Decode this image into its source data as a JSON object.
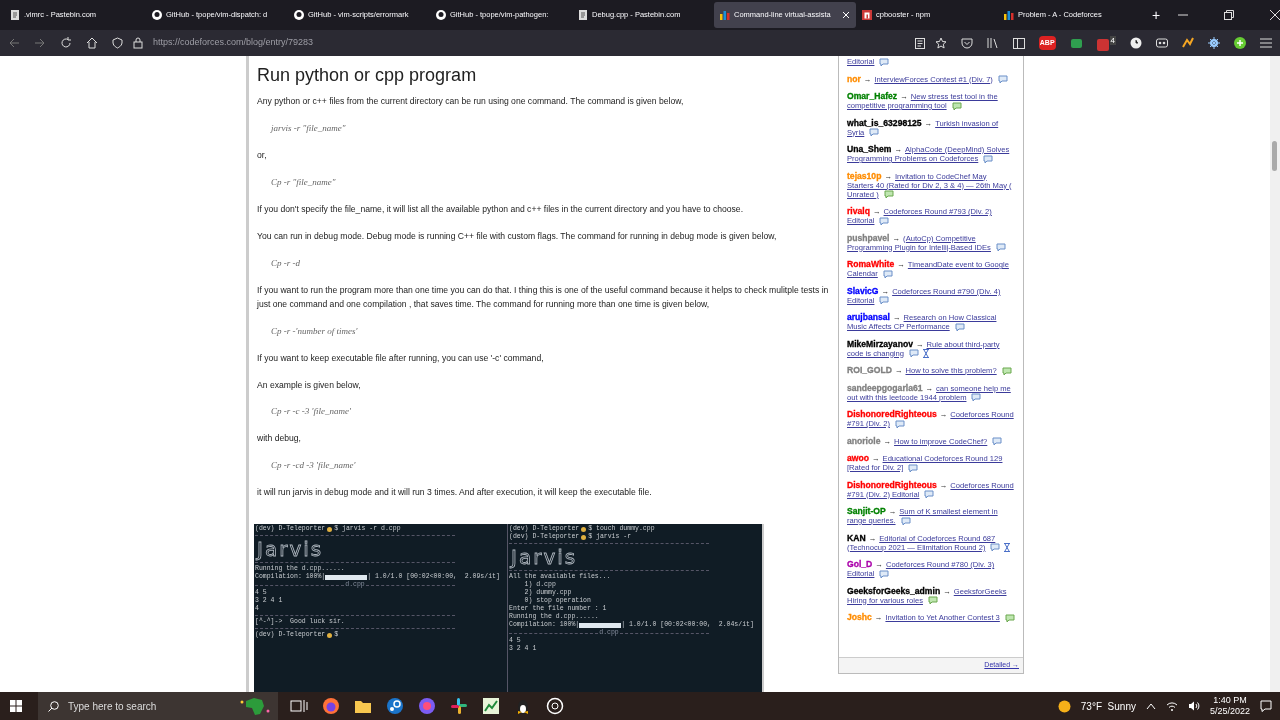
{
  "browser": {
    "tabs": [
      {
        "label": ".vimrc - Pastebin.com",
        "kind": "pastebin",
        "selected": false
      },
      {
        "label": "GitHub - tpope/vim-dispatch: d",
        "kind": "github",
        "selected": false
      },
      {
        "label": "GitHub - vim-scripts/errormark",
        "kind": "github",
        "selected": false
      },
      {
        "label": "GitHub - tpope/vim-pathogen:",
        "kind": "github",
        "selected": false
      },
      {
        "label": "Debug.cpp - Pastebin.com",
        "kind": "pastebin",
        "selected": false
      },
      {
        "label": "Command-line virtual-assista",
        "kind": "codeforces",
        "selected": true
      },
      {
        "label": "cpbooster - npm",
        "kind": "npm",
        "selected": false
      },
      {
        "label": "Problem - A - Codeforces",
        "kind": "codeforces",
        "selected": false
      }
    ],
    "new_tab": "+",
    "url": "https://codeforces.com/blog/entry/79283",
    "extensions": {
      "adblock_label": "ABP",
      "badge": "4"
    }
  },
  "article": {
    "blocks": [
      {
        "kind": "heading",
        "text": "Run python or cpp program"
      },
      {
        "kind": "para",
        "text": "Any python or c++ files from the current directory can be run using one command. The command is given below,"
      },
      {
        "kind": "code",
        "text": "jarvis -r \"file_name\""
      },
      {
        "kind": "para",
        "text": "or,"
      },
      {
        "kind": "code",
        "text": "Cp -r \"file_name\""
      },
      {
        "kind": "para",
        "text": "If you don't specify the file_name, it will list all the available python and c++ files in the current directory and you have to choose."
      },
      {
        "kind": "para",
        "text": "You can run in debug mode. Debug mode is running C++ file with custom flags. The command for running in debug mode is given below,"
      },
      {
        "kind": "code",
        "text": "Cp -r -d"
      },
      {
        "kind": "para",
        "text": "If you want to run the program more than one time you can do that. I thing this is one of the useful command because it helps to check mulitple tests in just one command and one compilation , that saves time. The command for running more than one time is given below,"
      },
      {
        "kind": "code",
        "text": "Cp -r -'number of times'"
      },
      {
        "kind": "para",
        "text": "If you want to keep executable file after running, you can use '-c' command,"
      },
      {
        "kind": "para",
        "text": "An example is given below,"
      },
      {
        "kind": "code",
        "text": "Cp -r -c -3 'file_name'"
      },
      {
        "kind": "para",
        "text": "with debug,"
      },
      {
        "kind": "code",
        "text": "Cp -r -cd -3 'file_name'"
      },
      {
        "kind": "para",
        "text": "it will run jarvis in debug mode and it will run 3 times. And after execution, it will keep the executable file."
      }
    ],
    "terminal_screenshot": {
      "panes": [
        {
          "lines": [
            {
              "kind": "prompt",
              "prefix": "(dev) D-Teleporter",
              "command": "$ jarvis -r d.cpp"
            },
            {
              "kind": "rule"
            },
            {
              "kind": "art",
              "text": "Jarvis"
            },
            {
              "kind": "rule"
            },
            {
              "kind": "text",
              "text": "Running the d.cpp......"
            },
            {
              "kind": "progress",
              "label": "Compilation: 100%|",
              "level": 1,
              "stats": "| 1.0/1.0 [00:02<00:00,  2.09s/it]"
            },
            {
              "kind": "rule",
              "text": "d.cpp"
            },
            {
              "kind": "text",
              "text": "4 5"
            },
            {
              "kind": "text",
              "text": "3 2 4 1"
            },
            {
              "kind": "text",
              "text": "4"
            },
            {
              "kind": "rule"
            },
            {
              "kind": "text",
              "text": "[^-^]->  Good luck sir."
            },
            {
              "kind": "rule"
            },
            {
              "kind": "prompt",
              "prefix": "(dev) D-Teleporter",
              "command": "$"
            }
          ]
        },
        {
          "lines": [
            {
              "kind": "prompt",
              "prefix": "(dev) D-Teleporter",
              "command": "$ touch dummy.cpp"
            },
            {
              "kind": "prompt",
              "prefix": "(dev) D-Teleporter",
              "command": "$ jarvis -r"
            },
            {
              "kind": "rule"
            },
            {
              "kind": "art",
              "text": "Jarvis"
            },
            {
              "kind": "rule"
            },
            {
              "kind": "text",
              "text": "All the available files..."
            },
            {
              "kind": "text",
              "text": "    1) d.cpp"
            },
            {
              "kind": "text",
              "text": "    2) dummy.cpp"
            },
            {
              "kind": "text",
              "text": "    0) stop operation"
            },
            {
              "kind": "text",
              "text": "Enter the file number : 1"
            },
            {
              "kind": "text",
              "text": "Running the d.cpp......"
            },
            {
              "kind": "progress",
              "label": "Compilation: 100%|",
              "level": 1,
              "stats": "| 1.0/1.0 [00:02<00:00,  2.04s/it]"
            },
            {
              "kind": "rule",
              "text": "d.cpp"
            },
            {
              "kind": "text",
              "text": "4 5"
            },
            {
              "kind": "text",
              "text": "3 2 4 1"
            }
          ]
        }
      ]
    }
  },
  "recent_actions": {
    "items": [
      {
        "title": "Editorial",
        "new_comments": false,
        "hourglass": false
      },
      {
        "user": "nor",
        "color": "#ff8c00",
        "title": "InterviewForces Contest #1 (Div. 7)",
        "new_comments": false,
        "hourglass": false
      },
      {
        "user": "Omar_Hafez",
        "color": "#008000",
        "title": "New stress test tool in the competitive programming tool",
        "new_comments": true,
        "hourglass": false
      },
      {
        "user": "what_is_63298125",
        "color": "#000000",
        "title": "Turkish invasion of Syria",
        "new_comments": false,
        "hourglass": false
      },
      {
        "user": "Una_Shem",
        "color": "#000000",
        "title": "AlphaCode (DeepMind) Solves Programming Problems on Codeforces",
        "new_comments": false,
        "hourglass": false
      },
      {
        "user": "tejas10p",
        "color": "#ff8c00",
        "title": "Invitation to CodeChef May Starters 40 (Rated for Div 2, 3 & 4) — 26th May ( Unrated )",
        "new_comments": true,
        "hourglass": false
      },
      {
        "user": "rivalq",
        "color": "#ff0000",
        "title": "Codeforces Round #793 (Div. 2) Editorial",
        "new_comments": false,
        "hourglass": false
      },
      {
        "user": "pushpavel",
        "color": "#808080",
        "title": "(AutoCp) Competitive Programming Plugin for Intellij-Based IDEs",
        "new_comments": false,
        "hourglass": false
      },
      {
        "user": "RomaWhite",
        "color": "#ff0000",
        "title": "TimeandDate event to Google Calendar",
        "new_comments": false,
        "hourglass": false
      },
      {
        "user": "SlavicG",
        "color": "#0000ff",
        "title": "Codeforces Round #790 (Div. 4) Editorial",
        "new_comments": false,
        "hourglass": false
      },
      {
        "user": "arujbansal",
        "color": "#0000ff",
        "title": "Research on How Classical Music Affects CP Performance",
        "new_comments": false,
        "hourglass": false
      },
      {
        "user": "MikeMirzayanov",
        "color": "#000000",
        "title": "Rule about third-party code is changing",
        "new_comments": false,
        "hourglass": true
      },
      {
        "user": "ROI_GOLD",
        "color": "#808080",
        "title": "How to solve this problem?",
        "new_comments": true,
        "hourglass": false
      },
      {
        "user": "sandeepgogarla61",
        "color": "#808080",
        "title": "can someone help me out with this leetcode 1944 problem",
        "new_comments": false,
        "hourglass": false
      },
      {
        "user": "DishonoredRighteous",
        "color": "#ff0000",
        "title": "Codeforces Round #791 (Div. 2)",
        "new_comments": false,
        "hourglass": false
      },
      {
        "user": "anoriole",
        "color": "#808080",
        "title": "How to improve CodeChef?",
        "new_comments": false,
        "hourglass": false
      },
      {
        "user": "awoo",
        "color": "#ff0000",
        "title": "Educational Codeforces Round 129 [Rated for Div. 2]",
        "new_comments": false,
        "hourglass": false
      },
      {
        "user": "DishonoredRighteous",
        "color": "#ff0000",
        "title": "Codeforces Round #791 (Div. 2) Editorial",
        "new_comments": false,
        "hourglass": false
      },
      {
        "user": "Sanjit-OP",
        "color": "#008000",
        "title": "Sum of K smallest element in range queries.",
        "new_comments": false,
        "hourglass": false
      },
      {
        "user": "KAN",
        "color": "#000000",
        "title": "Editorial of Codeforces Round 687 (Technocup 2021 — Elimitation Round 2)",
        "new_comments": false,
        "hourglass": true
      },
      {
        "user": "Gol_D",
        "color": "#aa00aa",
        "title": "Codeforces Round #780 (Div. 3) Editorial",
        "new_comments": false,
        "hourglass": false
      },
      {
        "user": "GeeksforGeeks_admin",
        "color": "#000000",
        "title": "GeeksforGeeks Hiring for various roles",
        "new_comments": true,
        "hourglass": false
      },
      {
        "user": "Joshc",
        "color": "#ff8c00",
        "title": "Invitation to Yet Another Contest 3",
        "new_comments": true,
        "hourglass": false
      }
    ],
    "arrow": "→",
    "footer_link": "Detailed →"
  },
  "taskbar": {
    "search_placeholder": "Type here to search",
    "weather": "73°F  Sunny",
    "time": "1:40 PM",
    "date": "5/25/2022"
  }
}
